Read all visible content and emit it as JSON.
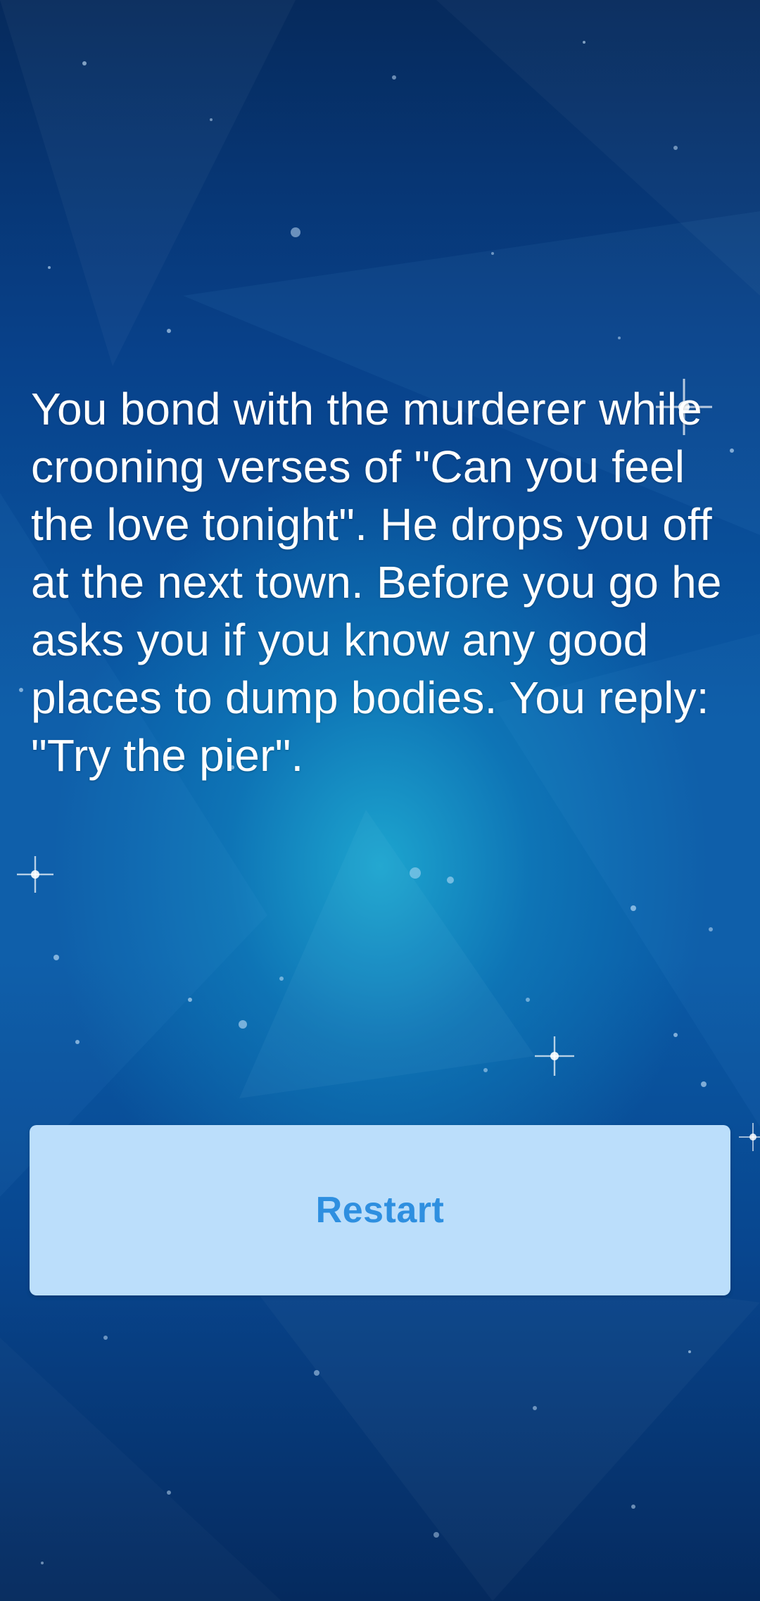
{
  "story": {
    "text": "You bond with the murderer while crooning verses of \"Can you feel the love tonight\". He drops you off at the next town. Before you go he asks you if you know any good places to dump bodies. You reply: \"Try the pier\"."
  },
  "actions": {
    "restart_label": "Restart"
  },
  "colors": {
    "background_dark": "#062a5c",
    "background_glow": "#20b2d6",
    "button_bg": "#bbdefb",
    "button_text": "#2e8fe0",
    "text": "#ffffff"
  }
}
